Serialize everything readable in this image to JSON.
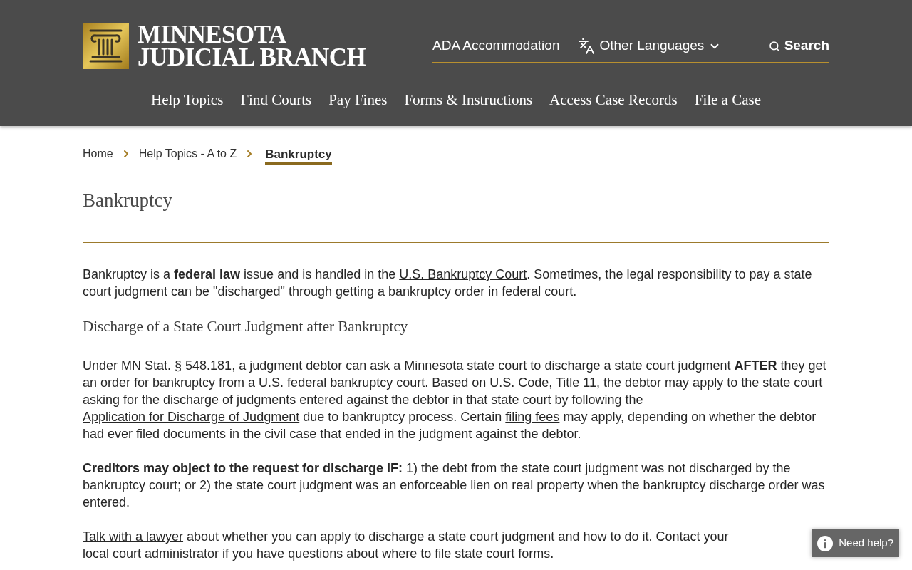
{
  "header": {
    "logo_lines": [
      "MINNESOTA",
      "JUDICIAL BRANCH"
    ],
    "utility_links": [
      {
        "kind": "link",
        "label": "ADA Accommodation"
      },
      {
        "kind": "language-menu",
        "label": "Other Languages"
      }
    ],
    "search": {
      "label": "Search"
    },
    "nav": [
      "Help Topics",
      "Find Courts",
      "Pay Fines",
      "Forms & Instructions",
      "Access Case Records",
      "File a Case"
    ]
  },
  "breadcrumb": [
    {
      "label": "Home",
      "selected": false
    },
    {
      "label": "Help Topics - A to Z",
      "selected": false
    },
    {
      "label": "Bankruptcy",
      "selected": true
    }
  ],
  "page_title": "Bankruptcy",
  "sections": [
    {
      "kind": "paragraph",
      "segments": [
        {
          "kind": "text",
          "text": "Bankruptcy is a **federal law** issue and is handled in the "
        },
        {
          "kind": "link",
          "text": "U.S. Bankruptcy Court"
        },
        {
          "kind": "text",
          "text": ". Sometimes, the legal responsibility to pay a state court judgment can be \"discharged\" through getting a bankruptcy order in federal court."
        }
      ]
    },
    {
      "kind": "heading",
      "text": "Discharge of a State Court Judgment after Bankruptcy"
    },
    {
      "kind": "paragraph",
      "segments": [
        {
          "kind": "text",
          "text": "Under "
        },
        {
          "kind": "link",
          "text": "MN Stat. § 548.181"
        },
        {
          "kind": "text",
          "text": ", a judgment debtor can ask a Minnesota state court to discharge a state court judgment **AFTER** they get an order for bankruptcy from a U.S. federal bankruptcy court. Based on "
        },
        {
          "kind": "link",
          "text": "U.S. Code, Title 11"
        },
        {
          "kind": "text",
          "text": ", the debtor may apply to the state court asking for the discharge of judgments entered against the debtor in that state court by following the "
        },
        {
          "kind": "link",
          "text": "Application for Discharge of Judgment"
        },
        {
          "kind": "text",
          "text": " due to bankruptcy process. Certain "
        },
        {
          "kind": "link",
          "text": "filing fees"
        },
        {
          "kind": "text",
          "text": " may apply, depending on whether the debtor had ever filed documents in the civil case that ended in the judgment against the debtor."
        }
      ]
    },
    {
      "kind": "paragraph",
      "segments": [
        {
          "kind": "text",
          "text": "**Creditors may object to the request for discharge IF:** 1) the debt from the state court judgment was not discharged by the bankruptcy court; or 2) the state court judgment was an enforceable lien on real property when the bankruptcy discharge order was entered."
        }
      ]
    },
    {
      "kind": "paragraph",
      "segments": [
        {
          "kind": "link",
          "text": "Talk with a lawyer"
        },
        {
          "kind": "text",
          "text": " about whether you can apply to discharge a state court judgment and how to do it. Contact your "
        },
        {
          "kind": "link",
          "text": "local court administrator"
        },
        {
          "kind": "text",
          "text": " if you have questions about where to file state court forms."
        }
      ]
    }
  ],
  "help_button": {
    "label": "Need help?"
  }
}
